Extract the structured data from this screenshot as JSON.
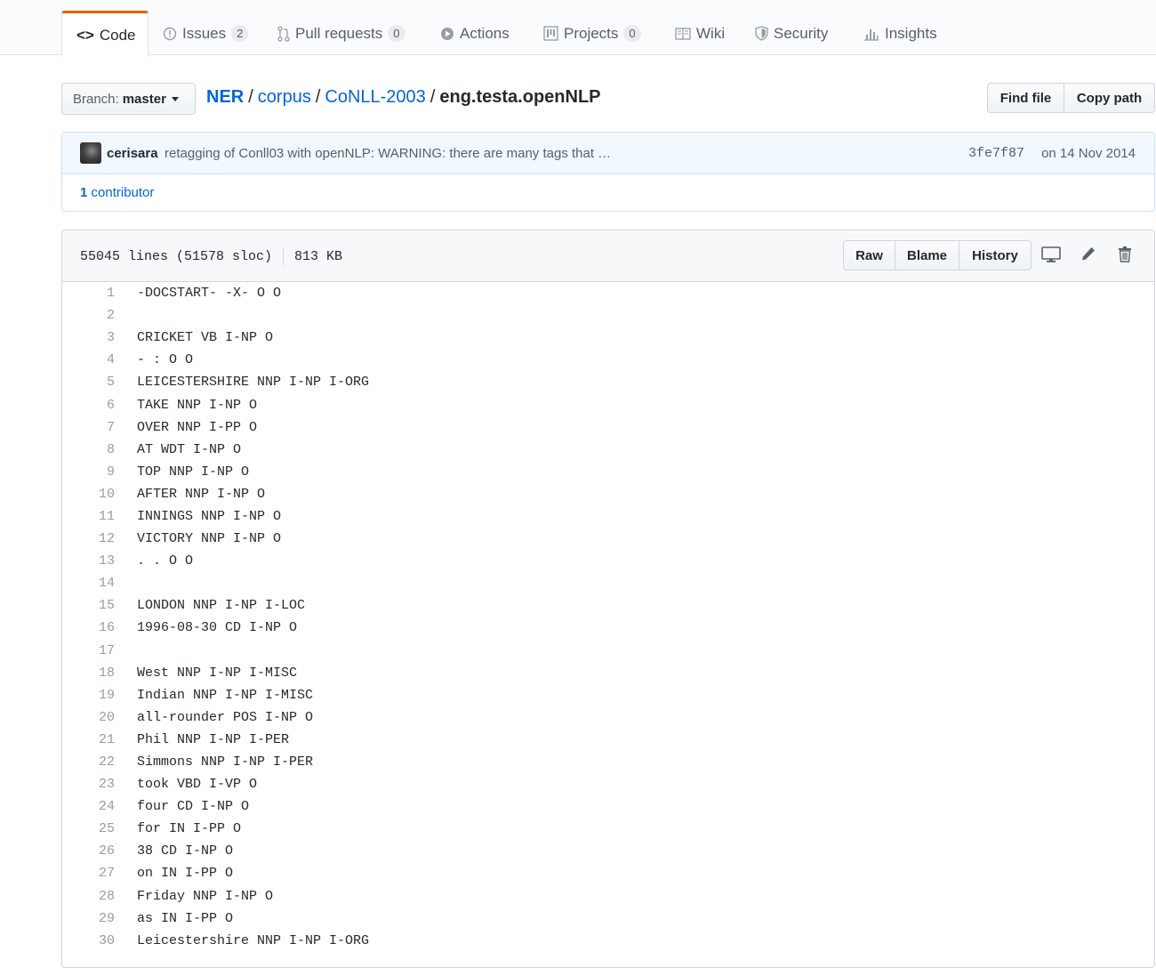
{
  "tabs": [
    {
      "label": "Code",
      "icon": "code-icon",
      "selected": true
    },
    {
      "label": "Issues",
      "icon": "issue-icon",
      "count": "2"
    },
    {
      "label": "Pull requests",
      "icon": "pull-request-icon",
      "count": "0"
    },
    {
      "label": "Actions",
      "icon": "play-icon"
    },
    {
      "label": "Projects",
      "icon": "project-icon",
      "count": "0"
    },
    {
      "label": "Wiki",
      "icon": "book-icon"
    },
    {
      "label": "Security",
      "icon": "shield-icon"
    },
    {
      "label": "Insights",
      "icon": "graph-icon"
    }
  ],
  "branch": {
    "prefix": "Branch:",
    "name": "master"
  },
  "breadcrumb": {
    "repo": "NER",
    "sep": "/",
    "path": [
      "corpus",
      "CoNLL-2003"
    ],
    "file": "eng.testa.openNLP"
  },
  "actions": {
    "find_file": "Find file",
    "copy_path": "Copy path"
  },
  "commit": {
    "author": "cerisara",
    "message": "retagging of Conll03 with openNLP: WARNING: there are many tags that …",
    "sha": "3fe7f87",
    "date": "on 14 Nov 2014",
    "contributors_count": "1",
    "contributors_label": "contributor"
  },
  "file": {
    "lines_info": "55045 lines (51578 sloc)",
    "size": "813 KB",
    "buttons": {
      "raw": "Raw",
      "blame": "Blame",
      "history": "History"
    }
  },
  "code_lines": [
    {
      "n": "1",
      "text": "-DOCSTART- -X- O O"
    },
    {
      "n": "2",
      "text": ""
    },
    {
      "n": "3",
      "text": "CRICKET VB I-NP O"
    },
    {
      "n": "4",
      "text": "- : O O"
    },
    {
      "n": "5",
      "text": "LEICESTERSHIRE NNP I-NP I-ORG"
    },
    {
      "n": "6",
      "text": "TAKE NNP I-NP O"
    },
    {
      "n": "7",
      "text": "OVER NNP I-PP O"
    },
    {
      "n": "8",
      "text": "AT WDT I-NP O"
    },
    {
      "n": "9",
      "text": "TOP NNP I-NP O"
    },
    {
      "n": "10",
      "text": "AFTER NNP I-NP O"
    },
    {
      "n": "11",
      "text": "INNINGS NNP I-NP O"
    },
    {
      "n": "12",
      "text": "VICTORY NNP I-NP O"
    },
    {
      "n": "13",
      "text": ". . O O"
    },
    {
      "n": "14",
      "text": ""
    },
    {
      "n": "15",
      "text": "LONDON NNP I-NP I-LOC"
    },
    {
      "n": "16",
      "text": "1996-08-30 CD I-NP O"
    },
    {
      "n": "17",
      "text": ""
    },
    {
      "n": "18",
      "text": "West NNP I-NP I-MISC"
    },
    {
      "n": "19",
      "text": "Indian NNP I-NP I-MISC"
    },
    {
      "n": "20",
      "text": "all-rounder POS I-NP O"
    },
    {
      "n": "21",
      "text": "Phil NNP I-NP I-PER"
    },
    {
      "n": "22",
      "text": "Simmons NNP I-NP I-PER"
    },
    {
      "n": "23",
      "text": "took VBD I-VP O"
    },
    {
      "n": "24",
      "text": "four CD I-NP O"
    },
    {
      "n": "25",
      "text": "for IN I-PP O"
    },
    {
      "n": "26",
      "text": "38 CD I-NP O"
    },
    {
      "n": "27",
      "text": "on IN I-PP O"
    },
    {
      "n": "28",
      "text": "Friday NNP I-NP O"
    },
    {
      "n": "29",
      "text": "as IN I-PP O"
    },
    {
      "n": "30",
      "text": "Leicestershire NNP I-NP I-ORG"
    }
  ]
}
